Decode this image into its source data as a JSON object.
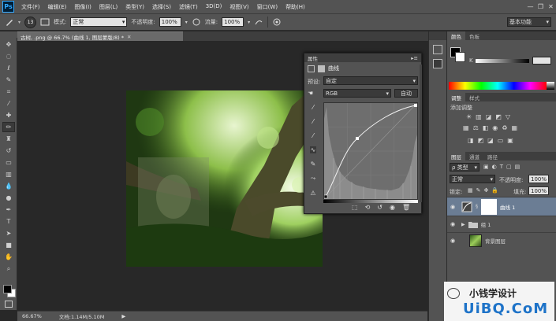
{
  "app": {
    "logo": "Ps",
    "window_controls": [
      "—",
      "❐",
      "✕"
    ]
  },
  "menu": [
    "文件(F)",
    "编辑(E)",
    "图像(I)",
    "图层(L)",
    "类型(Y)",
    "选择(S)",
    "滤镜(T)",
    "3D(D)",
    "视图(V)",
    "窗口(W)",
    "帮助(H)"
  ],
  "options": {
    "brush_size": "13",
    "mode_label": "模式:",
    "mode_value": "正常",
    "opacity_label": "不透明度:",
    "opacity_value": "100%",
    "flow_label": "流量:",
    "flow_value": "100%",
    "workspace": "基本功能"
  },
  "document": {
    "tab_title": "古树, .png @ 66.7% (曲线 1, 图层蒙版/8) *",
    "zoom": "66.67%",
    "doc_info": "文档:1.14M/5.10M"
  },
  "properties": {
    "tab": "属性",
    "title": "曲线",
    "preset_label": "预设:",
    "preset_value": "自定",
    "channel_value": "RGB",
    "auto_button": "自动"
  },
  "color_panel": {
    "tabs": [
      "颜色",
      "色板"
    ],
    "slider_label": "K"
  },
  "adjustments": {
    "tabs": [
      "调整",
      "样式"
    ],
    "title": "添加调整"
  },
  "layers": {
    "tabs": [
      "图层",
      "通道",
      "路径"
    ],
    "filter_label": "ρ 类型",
    "blend_value": "正常",
    "opacity_label": "不透明度:",
    "opacity_value": "100%",
    "lock_label": "锁定:",
    "fill_label": "填充:",
    "fill_value": "100%",
    "items": [
      {
        "name": "曲线 1"
      },
      {
        "name": "组 1"
      },
      {
        "name": "背景图层"
      }
    ]
  },
  "watermark": {
    "brand": "小钱学设计",
    "site": "UiBQ.CoM"
  },
  "colors": {
    "ui_bg": "#535353",
    "canvas_bg": "#282828",
    "selected_layer": "#6b7d94"
  }
}
